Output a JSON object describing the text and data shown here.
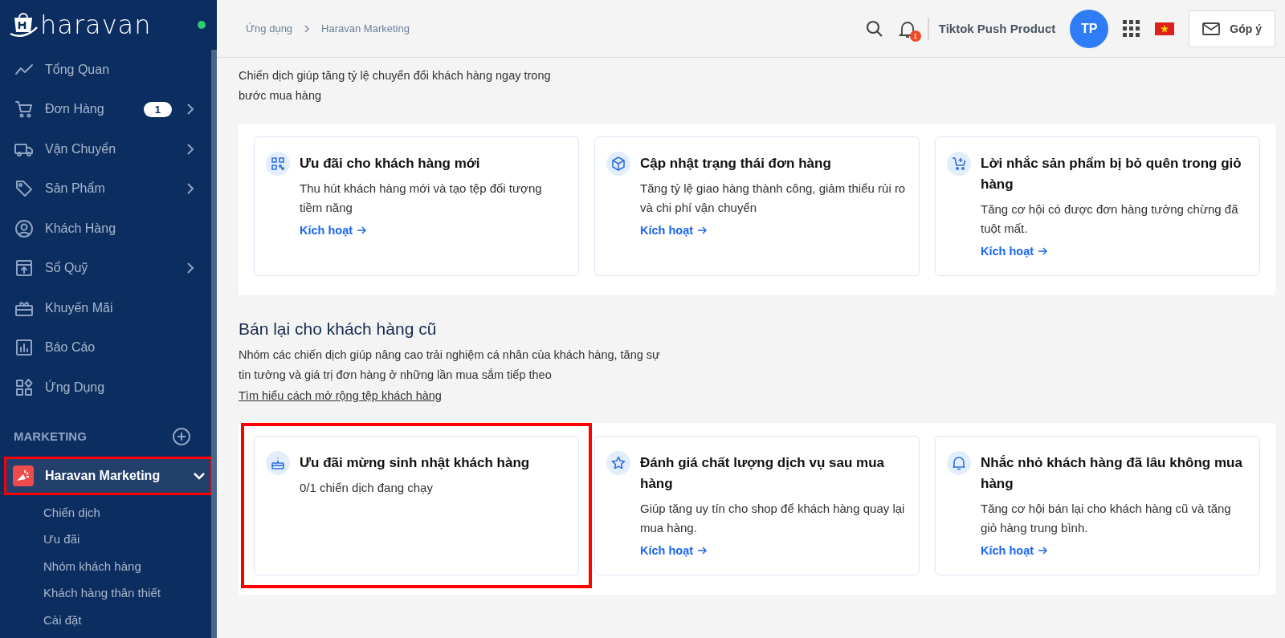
{
  "logo": {
    "text": "haravan",
    "online": true
  },
  "sidebar": {
    "items": [
      {
        "label": "Tổng Quan",
        "expandable": false
      },
      {
        "label": "Đơn Hàng",
        "badge": "1",
        "expandable": true
      },
      {
        "label": "Vận Chuyển",
        "expandable": true
      },
      {
        "label": "Sản Phẩm",
        "expandable": true
      },
      {
        "label": "Khách Hàng",
        "expandable": false
      },
      {
        "label": "Sổ Quỹ",
        "expandable": true
      },
      {
        "label": "Khuyến Mãi",
        "expandable": false
      },
      {
        "label": "Báo Cáo",
        "expandable": false
      },
      {
        "label": "Ứng Dụng",
        "expandable": false
      }
    ],
    "section_heading": "MARKETING",
    "app": {
      "label": "Haravan Marketing",
      "expanded": true,
      "highlighted": true
    },
    "subitems": [
      "Chiến dịch",
      "Ưu đãi",
      "Nhóm khách hàng",
      "Khách hàng thân thiết",
      "Cài đặt"
    ]
  },
  "topbar": {
    "breadcrumb": [
      "Ứng dụng",
      "Haravan Marketing"
    ],
    "notification_count": "1",
    "shop_name": "Tiktok Push Product",
    "avatar": "TP",
    "feedback": "Góp ý"
  },
  "sections": [
    {
      "description": "Chiến dịch giúp tăng tỷ lệ chuyển đổi khách hàng ngay trong bước mua hàng",
      "cards": [
        {
          "title": "Ưu đãi cho khách hàng mới",
          "description": "Thu hút khách hàng mới và tạo tệp đối tượng tiềm năng",
          "action": "Kích hoạt",
          "highlighted": false
        },
        {
          "title": "Cập nhật trạng thái đơn hàng",
          "description": "Tăng tỷ lệ giao hàng thành công, giảm thiểu rủi ro và chi phí vận chuyển",
          "action": "Kích hoạt",
          "highlighted": false
        },
        {
          "title": "Lời nhắc sản phẩm bị bỏ quên trong giỏ hàng",
          "description": "Tăng cơ hội có được đơn hàng tưởng chừng đã tuột mất.",
          "action": "Kích hoạt",
          "highlighted": false
        }
      ]
    },
    {
      "title": "Bán lại cho khách hàng cũ",
      "description": "Nhóm các chiến dịch giúp nâng cao trải nghiệm cá nhân của khách hàng, tăng sự tin tưởng và giá trị đơn hàng ở những lần mua sắm tiếp theo",
      "link": "Tìm hiểu cách mở rộng tệp khách hàng",
      "cards": [
        {
          "title": "Ưu đãi mừng sinh nhật khách hàng",
          "description": "0/1 chiến dịch đang chạy",
          "highlighted": true
        },
        {
          "title": "Đánh giá chất lượng dịch vụ sau mua hàng",
          "description": "Giúp tăng uy tín cho shop để khách hàng quay lại mua hàng.",
          "action": "Kích hoạt",
          "highlighted": false
        },
        {
          "title": "Nhắc nhỏ khách hàng đã lâu không mua hàng",
          "description": "Tăng cơ hội bán lại cho khách hàng cũ và tăng giỏ hàng trung bình.",
          "action": "Kích hoạt",
          "highlighted": false
        }
      ]
    }
  ]
}
